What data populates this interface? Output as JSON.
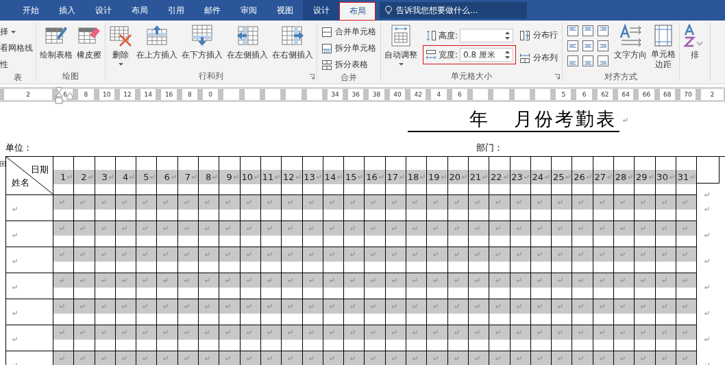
{
  "tabs": [
    {
      "label": "开始",
      "kind": "main",
      "selected": false,
      "highlighted": false
    },
    {
      "label": "插入",
      "kind": "main",
      "selected": false,
      "highlighted": false
    },
    {
      "label": "设计",
      "kind": "main",
      "selected": false,
      "highlighted": false
    },
    {
      "label": "布局",
      "kind": "main",
      "selected": false,
      "highlighted": false
    },
    {
      "label": "引用",
      "kind": "main",
      "selected": false,
      "highlighted": false
    },
    {
      "label": "邮件",
      "kind": "main",
      "selected": false,
      "highlighted": false
    },
    {
      "label": "审阅",
      "kind": "main",
      "selected": false,
      "highlighted": false
    },
    {
      "label": "视图",
      "kind": "main",
      "selected": false,
      "highlighted": false
    },
    {
      "label": "设计",
      "kind": "contextual",
      "selected": false,
      "highlighted": false
    },
    {
      "label": "布局",
      "kind": "contextual",
      "selected": true,
      "highlighted": true
    }
  ],
  "tell_me": {
    "placeholder": "告诉我您想要做什么..."
  },
  "ribbon": [
    {
      "kind": "list",
      "label": "表",
      "launcher": false,
      "items": [
        {
          "label": "择",
          "dropdown": true
        },
        {
          "label": "看网格线",
          "dropdown": false
        },
        {
          "label": "性",
          "dropdown": false
        }
      ]
    },
    {
      "kind": "large",
      "label": "绘图",
      "launcher": false,
      "buttons": [
        {
          "label": "绘制表格",
          "kind": "draw-table",
          "dropdown": false
        },
        {
          "label": "橡皮擦",
          "kind": "eraser",
          "dropdown": false
        }
      ]
    },
    {
      "kind": "large",
      "label": "行和列",
      "launcher": true,
      "buttons": [
        {
          "label": "删除",
          "kind": "delete",
          "dropdown": true
        },
        {
          "label": "在上方插入",
          "kind": "insert-above",
          "dropdown": false
        },
        {
          "label": "在下方插入",
          "kind": "insert-below",
          "dropdown": false
        },
        {
          "label": "在左侧插入",
          "kind": "insert-left",
          "dropdown": false
        },
        {
          "label": "在右侧插入",
          "kind": "insert-right",
          "dropdown": false
        }
      ]
    },
    {
      "kind": "small",
      "label": "合并",
      "launcher": false,
      "items": [
        {
          "label": "合并单元格",
          "kind": "merge"
        },
        {
          "label": "拆分单元格",
          "kind": "split-cells"
        },
        {
          "label": "拆分表格",
          "kind": "split-table"
        }
      ]
    },
    {
      "kind": "cell-size",
      "label": "单元格大小",
      "launcher": true,
      "auto_fit": {
        "label": "自动调整",
        "dropdown": true
      },
      "fields": [
        {
          "label": "高度:",
          "kind": "height",
          "highlighted": false
        },
        {
          "label": "宽度:",
          "kind": "width",
          "value": "0.8 厘米",
          "highlighted": true
        }
      ],
      "distribute": [
        {
          "label": "分布行",
          "kind": "rows"
        },
        {
          "label": "分布列",
          "kind": "columns"
        }
      ]
    },
    {
      "kind": "alignment",
      "label": "对齐方式",
      "launcher": false,
      "buttons": [
        {
          "label": "文字方向",
          "kind": "text-direction",
          "dropdown": false
        },
        {
          "label": "单元格边距",
          "kind": "cell-margins",
          "dropdown": false
        }
      ]
    },
    {
      "kind": "large",
      "launcher": false,
      "buttons": [
        {
          "label": "排",
          "kind": "sort",
          "dropdown": false
        }
      ]
    }
  ],
  "ruler": [
    {
      "kind": "number",
      "label": "2"
    },
    {
      "kind": "number",
      "label": "6"
    },
    {
      "kind": "number",
      "label": "8"
    },
    {
      "kind": "number",
      "label": "10"
    },
    {
      "kind": "number",
      "label": "12"
    },
    {
      "kind": "number",
      "label": "14"
    },
    {
      "kind": "number",
      "label": "16"
    },
    {
      "kind": "number",
      "label": "8"
    },
    {
      "kind": "number",
      "label": "0"
    },
    {
      "kind": "blank"
    },
    {
      "kind": "blank"
    },
    {
      "kind": "blank"
    },
    {
      "kind": "blank"
    },
    {
      "kind": "blank"
    },
    {
      "kind": "number",
      "label": "34"
    },
    {
      "kind": "number",
      "label": "36"
    },
    {
      "kind": "number",
      "label": "38"
    },
    {
      "kind": "number",
      "label": "40"
    },
    {
      "kind": "number",
      "label": "42"
    },
    {
      "kind": "number",
      "label": "4"
    },
    {
      "kind": "number",
      "label": "6"
    },
    {
      "kind": "blank"
    },
    {
      "kind": "blank"
    },
    {
      "kind": "blank"
    },
    {
      "kind": "blank"
    },
    {
      "kind": "number",
      "label": "5"
    },
    {
      "kind": "number",
      "label": "6"
    },
    {
      "kind": "number",
      "label": "62"
    },
    {
      "kind": "number",
      "label": "64"
    },
    {
      "kind": "number",
      "label": "66"
    },
    {
      "kind": "number",
      "label": "68"
    },
    {
      "kind": "number",
      "label": "70"
    },
    {
      "kind": "number",
      "label": "2"
    }
  ],
  "document": {
    "title": "年   月份考勤表",
    "unit_label": "单位：",
    "dept_label": "部门：",
    "table": {
      "corner": {
        "top": "日期",
        "bottom": "姓名"
      },
      "days": [
        "1",
        "2",
        "3",
        "4",
        "5",
        "6",
        "7",
        "8",
        "9",
        "10",
        "11",
        "12",
        "13",
        "14",
        "15",
        "16",
        "17",
        "18",
        "19",
        "20",
        "21",
        "22",
        "23",
        "24",
        "25",
        "26",
        "27",
        "28",
        "29",
        "30",
        "31"
      ],
      "rows": [
        {
          "kind": "blank"
        },
        {
          "kind": "blank"
        },
        {
          "kind": "blank"
        },
        {
          "kind": "blank"
        },
        {
          "kind": "blank"
        },
        {
          "kind": "blank"
        },
        {
          "kind": "blank"
        }
      ]
    }
  }
}
